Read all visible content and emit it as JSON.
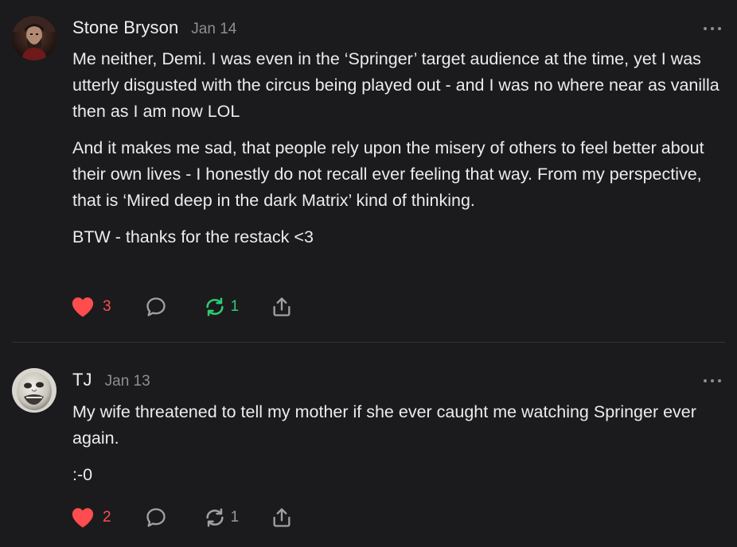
{
  "comments": [
    {
      "author": "Stone Bryson",
      "date": "Jan 14",
      "paragraphs": [
        "Me neither, Demi. I was even in the ‘Springer’ target audience at the time, yet I was utterly disgusted with the circus being played out - and I was no where near as vanilla then as I am now LOL",
        "And it makes me sad, that people rely upon the misery of others to feel better about their own lives - I honestly do not recall ever feeling that way. From my perspective, that is ‘Mired deep in the dark Matrix’ kind of thinking.",
        "BTW - thanks for the restack <3"
      ],
      "likes": "3",
      "restacks": "1",
      "restacked": true
    },
    {
      "author": "TJ",
      "date": "Jan 13",
      "paragraphs": [
        "My wife threatened to tell my mother if she ever caught me watching Springer ever again.",
        ":-0"
      ],
      "likes": "2",
      "restacks": "1",
      "restacked": false
    }
  ],
  "colors": {
    "like": "#ff4d4f",
    "restack_active": "#2ecc71",
    "icon_muted": "#9a9a9e",
    "background": "#1b1b1d"
  },
  "icons": [
    "heart-icon",
    "comment-bubble-icon",
    "restack-icon",
    "share-icon",
    "more-options-icon"
  ]
}
